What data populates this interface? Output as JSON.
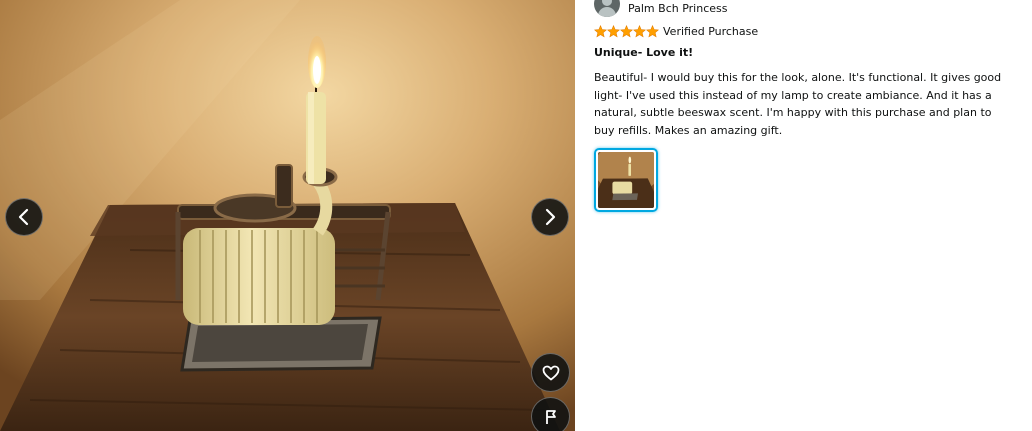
{
  "viewer": {
    "image_alt": "customer review photo",
    "prev_label": "Previous image",
    "next_label": "Next image",
    "like_label": "Like",
    "report_label": "Report"
  },
  "review": {
    "reviewer_name": "Palm Bch Princess",
    "rating": 5,
    "rating_max": 5,
    "verified_label": "Verified Purchase",
    "title": "Unique- Love it!",
    "body": "Beautiful- I would buy this for the look, alone. It's functional. It gives good light- I've used this instead of my lamp to create ambiance. And it has a natural, subtle beeswax scent. I'm happy with this purchase and plan to buy refills. Makes an amazing gift."
  },
  "colors": {
    "star": "#ff9f00",
    "thumb_border": "#00a8e1",
    "button_bg": "#0f1111"
  },
  "icons": {
    "prev": "chevron-left-icon",
    "next": "chevron-right-icon",
    "like": "heart-icon",
    "report": "flag-icon"
  }
}
